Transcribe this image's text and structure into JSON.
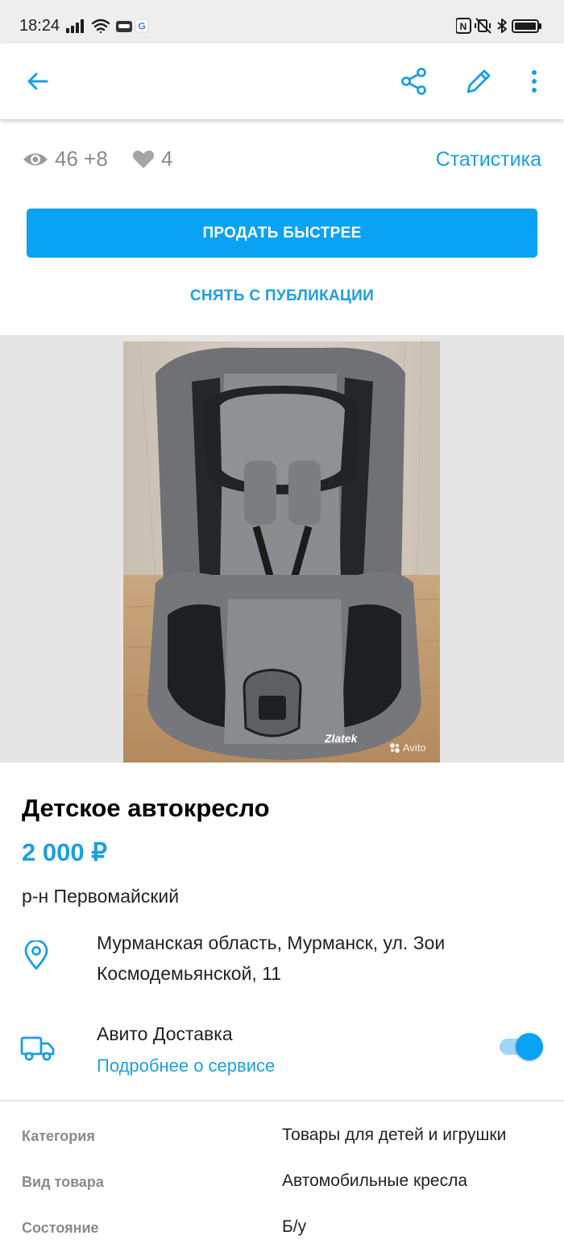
{
  "status_bar": {
    "time": "18:24",
    "left_icons": [
      "signal-icon",
      "wifi-icon",
      "car-app-icon",
      "google-icon"
    ],
    "right_icons": [
      "nfc-icon",
      "vibrate-icon",
      "bluetooth-icon",
      "battery-icon"
    ],
    "google_letter": "G"
  },
  "app_bar": {
    "back_icon": "arrow-left-icon",
    "actions": [
      "share-icon",
      "edit-icon",
      "more-vertical-icon"
    ]
  },
  "stats": {
    "views": "46 +8",
    "favorites": "4",
    "statistics_link": "Статистика"
  },
  "actions": {
    "sell_faster": "ПРОДАТЬ БЫСТРЕЕ",
    "unpublish": "СНЯТЬ С ПУБЛИКАЦИИ"
  },
  "photo": {
    "brand_text": "Zlatek",
    "watermark": "Avito"
  },
  "listing": {
    "title": "Детское автокресло",
    "price": "2 000 ₽",
    "district": "р-н Первомайский",
    "address": "Мурманская область, Мурманск, ул. Зои Космодемьянской, 11"
  },
  "delivery": {
    "title": "Авито Доставка",
    "link": "Подробнее о сервисе",
    "enabled": true
  },
  "params": [
    {
      "label": "Категория",
      "value": "Товары для детей и игрушки"
    },
    {
      "label": "Вид товара",
      "value": "Автомобильные кресла"
    },
    {
      "label": "Состояние",
      "value": "Б/у"
    }
  ],
  "colors": {
    "accent": "#0aa2f5",
    "link": "#1a9fe0",
    "muted": "#8b8b8b"
  }
}
